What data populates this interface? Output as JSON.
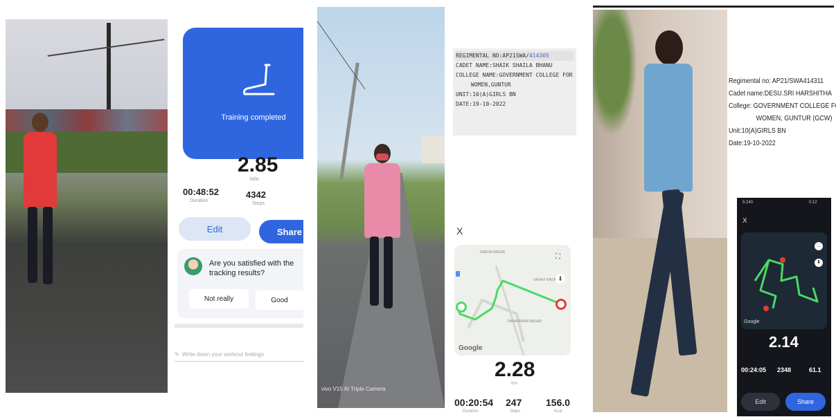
{
  "panel1": {
    "training_status": "Training completed",
    "distance": "2.85",
    "distance_unit": "Mile",
    "duration": "00:48:52",
    "duration_label": "Duration",
    "steps": "4342",
    "steps_label": "Steps",
    "edit_label": "Edit",
    "share_label": "Share",
    "question": "Are you satisfied with the tracking results?",
    "not_really_label": "Not really",
    "good_label": "Good",
    "feelings_placeholder": "Write down your workout feelings"
  },
  "panel2": {
    "regimental_no_prefix": "REGIMENTAL NO:AP21SWA/",
    "regimental_no_suffix": "414305",
    "cadet_name": "CADET NAME:SHAIK SHAILA BHANU",
    "college_name": "COLLEGE NAME:GOVERNMENT COLLEGE FOR",
    "college_name_2": "WOMEN,GUNTUR",
    "unit": "UNIT:10(A)GIRLS BN",
    "date": "DATE:19-10-2022",
    "close": "X",
    "map_labels": [
      "SNEHA NAGAR",
      "VASAVI NAGAR",
      "TARAKARAM NAGAR"
    ],
    "map_logo": "Google",
    "distance": "2.28",
    "distance_unit": "Km",
    "duration": "00:20:54",
    "duration_label": "Duration",
    "steps": "247",
    "steps_label": "Steps",
    "calories": "156.0",
    "calories_label": "Kcal",
    "camera_watermark": "vivo V15 AI Triple Camera"
  },
  "panel3": {
    "regimental_no": "Regimental no: AP21/SWA414311",
    "cadet_name": "Cadet name:DESU.SRI HARSHITHA",
    "college": "College: GOVERNMENT COLLEGE FOR",
    "college_2": "WOMEN, GUNTUR (GCW)",
    "unit": "Unit:10(A)GIRLS BN",
    "date": "Date:19-10-2022",
    "close": "X",
    "map_logo": "Google",
    "distance": "2.14",
    "duration": "00:24:05",
    "steps": "2348",
    "calories": "61.1",
    "edit_label": "Edit",
    "share_label": "Share",
    "status_left": "5:240",
    "status_right": "0:12"
  },
  "colors": {
    "accent_blue": "#2f66e0",
    "route_green": "#4cd964",
    "end_red": "#e53935"
  }
}
